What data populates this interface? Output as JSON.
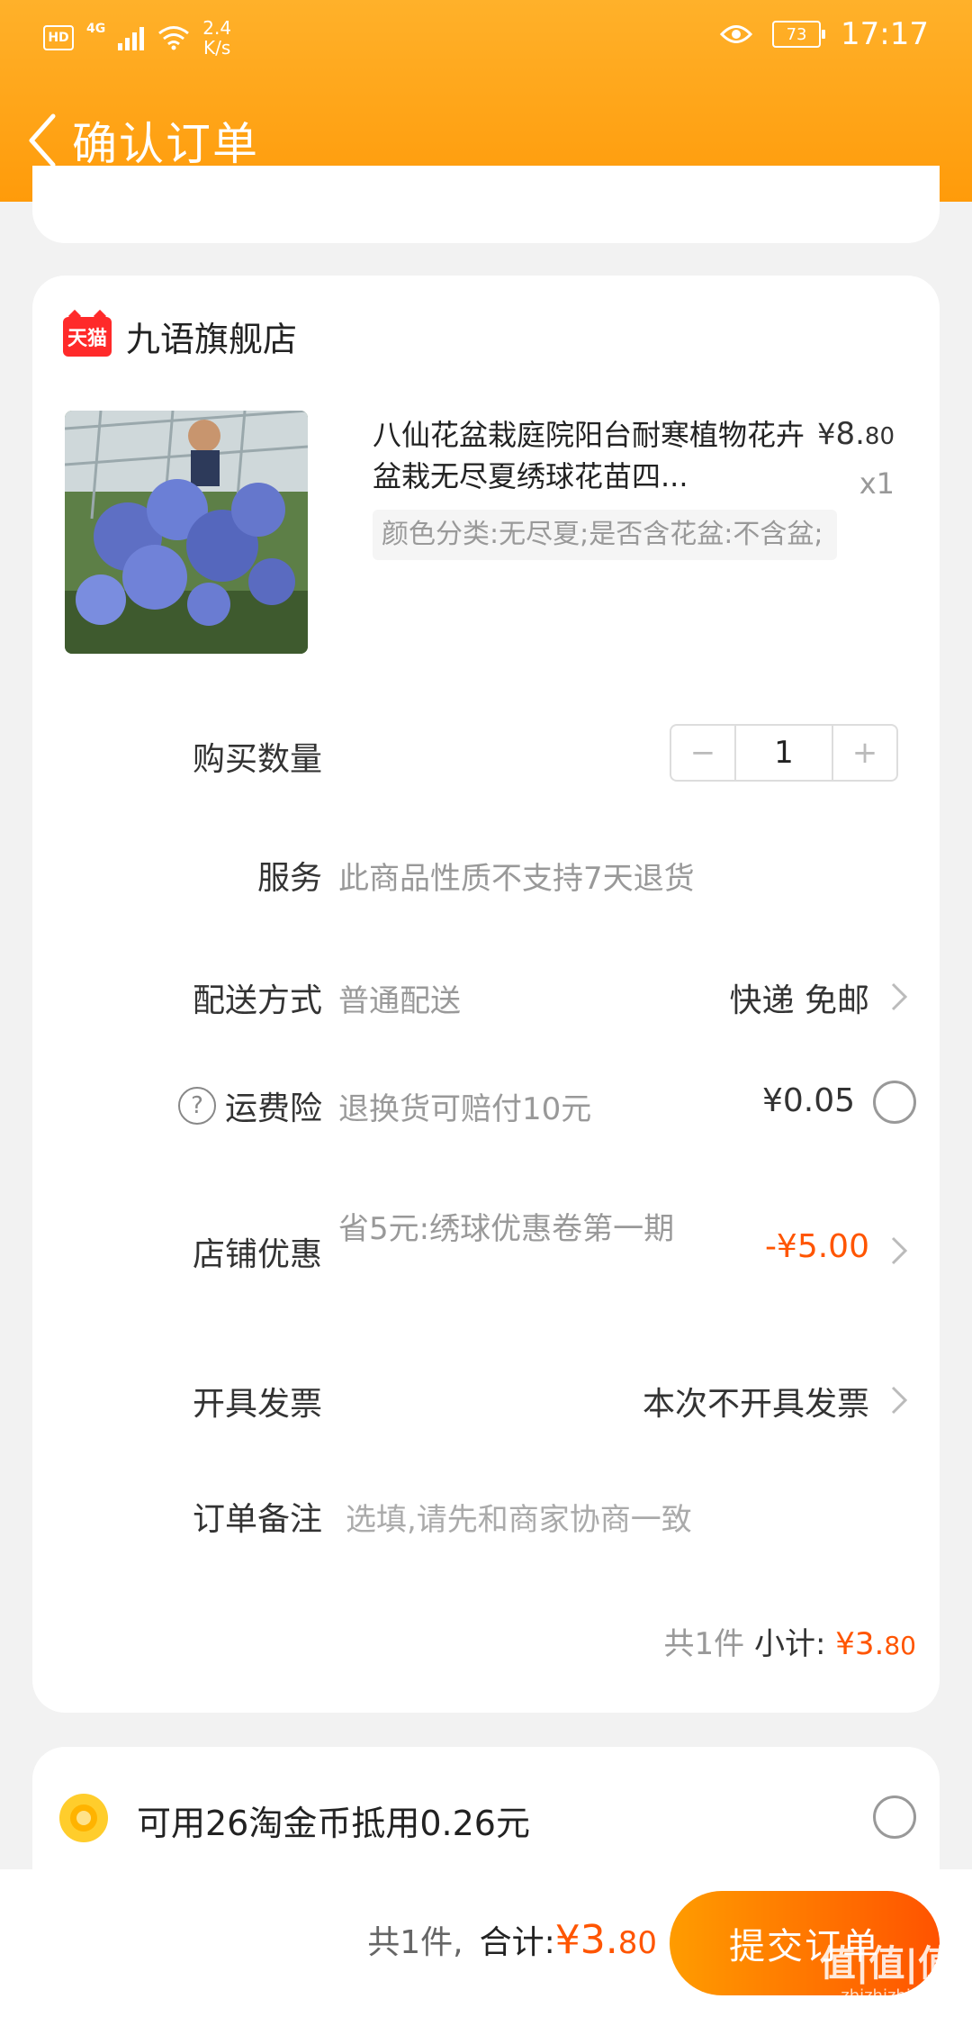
{
  "status_bar": {
    "network_badge": "HD",
    "network_type": "4G",
    "speed_value": "2.4",
    "speed_unit": "K/s",
    "battery": "73",
    "time": "17:17"
  },
  "header": {
    "title": "确认订单"
  },
  "store": {
    "badge": "天猫",
    "name": "九语旗舰店"
  },
  "product": {
    "title": "八仙花盆栽庭院阳台耐寒植物花卉盆栽无尽夏绣球花苗四...",
    "sku": "颜色分类:无尽夏;是否含花盆:不含盆;",
    "price_symbol": "¥",
    "price_int": "8.",
    "price_dec": "80",
    "qty": "x1"
  },
  "quantity": {
    "label": "购买数量",
    "minus": "−",
    "value": "1",
    "plus": "+"
  },
  "service": {
    "label": "服务",
    "value": "此商品性质不支持7天退货"
  },
  "delivery": {
    "label": "配送方式",
    "value": "普通配送",
    "right": "快递 免邮"
  },
  "insurance": {
    "help": "?",
    "label": "运费险",
    "value": "退换货可赔付10元",
    "right": "¥0.05"
  },
  "shop_discount": {
    "label": "店铺优惠",
    "value": "省5元:绣球优惠卷第一期",
    "right": "-¥5.00"
  },
  "invoice": {
    "label": "开具发票",
    "right": "本次不开具发票"
  },
  "note": {
    "label": "订单备注",
    "placeholder": "选填,请先和商家协商一致"
  },
  "subtotal": {
    "count": "共1件",
    "label": "小计:",
    "symbol": "¥",
    "int": "3.",
    "dec": "80"
  },
  "coins": {
    "text": "可用26淘金币抵用0.26元"
  },
  "footer": {
    "count": "共1件,",
    "total_label": "合计:",
    "symbol": "¥",
    "int": "3.",
    "dec": "80",
    "submit": "提交订单"
  },
  "watermark": {
    "main": "值|值|值",
    "sub": "zhizhizhi.com"
  },
  "colors": {
    "accent": "#ff5500",
    "header": "#ffa719"
  }
}
